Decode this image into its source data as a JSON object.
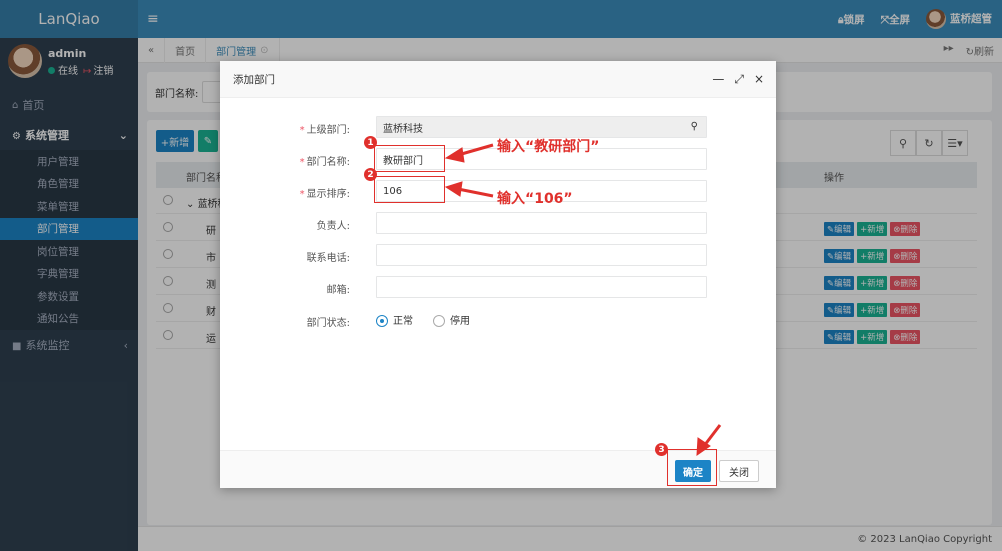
{
  "app": {
    "logo": "LanQiao"
  },
  "user": {
    "name": "admin",
    "status": "在线",
    "logout": "注销"
  },
  "sidebar": {
    "home": "首页",
    "group_system": "系统管理",
    "sub_items": [
      "用户管理",
      "角色管理",
      "菜单管理",
      "部门管理",
      "岗位管理",
      "字典管理",
      "参数设置",
      "通知公告"
    ],
    "group_monitor": "系统监控"
  },
  "topbar": {
    "lock": "锁屏",
    "fullscreen": "全屏",
    "username": "蓝桥超管"
  },
  "tabs": {
    "home": "首页",
    "dept": "部门管理",
    "refresh": "刷新"
  },
  "search": {
    "label": "部门名称:"
  },
  "toolbar": {
    "add": "+新增",
    "edit": "✎"
  },
  "table": {
    "header_name": "部门名称",
    "header_op": "操作",
    "tree_root": "蓝桥科",
    "rows": [
      "研",
      "市",
      "测",
      "财",
      "运"
    ],
    "op_edit": "✎编辑",
    "op_add": "+新增",
    "op_del": "⊗删除"
  },
  "modal": {
    "title": "添加部门",
    "parent_label": "上级部门:",
    "parent_value": "蓝桥科技",
    "name_label": "部门名称:",
    "name_value": "教研部门",
    "order_label": "显示排序:",
    "order_value": "106",
    "leader_label": "负责人:",
    "phone_label": "联系电话:",
    "email_label": "邮箱:",
    "status_label": "部门状态:",
    "status_normal": "正常",
    "status_disabled": "停用",
    "ok": "确定",
    "close": "关闭"
  },
  "annotations": {
    "badge1": "1",
    "badge2": "2",
    "badge3": "3",
    "text1": "输入“教研部门”",
    "text2": "输入“106”"
  },
  "footer": {
    "copyright": "© 2023 LanQiao Copyright"
  },
  "colors": {
    "accent": "#1c84c6",
    "annotation": "#e0302c",
    "sidebar": "#2f4050",
    "topbar": "#3c8dbc"
  }
}
